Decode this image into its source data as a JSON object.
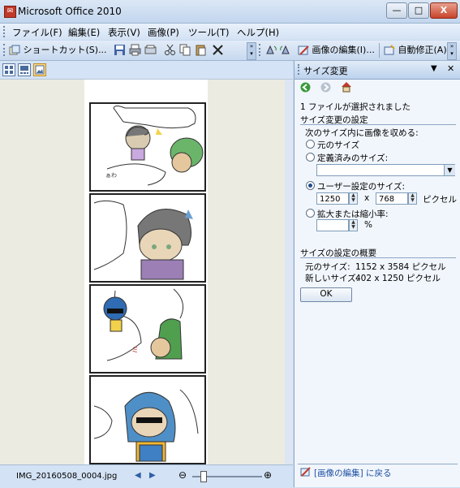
{
  "window": {
    "title": "Microsoft Office 2010",
    "app_icon": "office-app-icon",
    "minimize": "—",
    "maximize": "□",
    "close": "X"
  },
  "menu": [
    "ファイル(F)",
    "編集(E)",
    "表示(V)",
    "画像(P)",
    "ツール(T)",
    "ヘルプ(H)"
  ],
  "toolbar": {
    "shortcut_label": "ショートカット(S)...",
    "edit_picture_label": "画像の編集(I)...",
    "auto_correct_label": "自動修正(A)"
  },
  "status": {
    "filename": "IMG_20160508_0004.jpg",
    "prev": "◀",
    "next": "▶",
    "zoom_out": "⊖",
    "zoom_in": "⊕",
    "zoom_level": 0.15
  },
  "task_pane": {
    "title": "サイズ変更",
    "selected_info": "1 ファイルが選択されました",
    "section_resize": "サイズ変更の設定",
    "fit_label": "次のサイズ内に画像を収める:",
    "option_original": "元のサイズ",
    "option_predefined": "定義済みのサイズ:",
    "predefined_value": "",
    "option_custom": "ユーザー設定のサイズ:",
    "width_value": "1250",
    "times": "x",
    "height_value": "768",
    "pixel_unit": "ピクセル",
    "option_scale": "拡大または縮小率:",
    "scale_value": "",
    "percent": "%",
    "section_summary": "サイズの設定の概要",
    "original_size_label": "元のサイズ:",
    "original_size_value": "1152 x 3584 ピクセル",
    "new_size_label": "新しいサイズ:",
    "new_size_value": "402 x 1250 ピクセル",
    "ok_label": "OK",
    "back_link": "[画像の編集] に戻る"
  }
}
